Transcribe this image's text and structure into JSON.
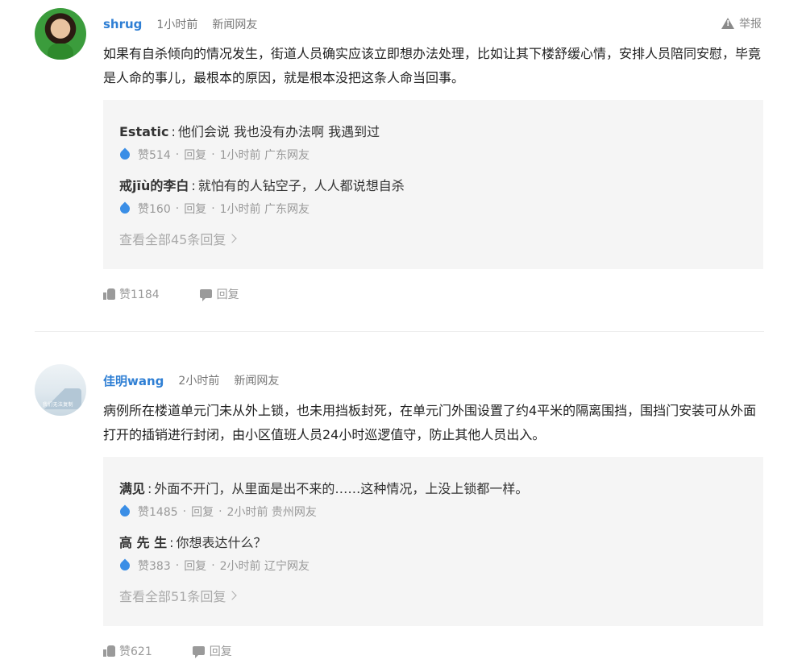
{
  "report_label": "举报",
  "comments": [
    {
      "username": "shrug",
      "time": "1小时前",
      "source": "新闻网友",
      "text": "如果有自杀倾向的情况发生，街道人员确实应该立即想办法处理，比如让其下楼舒缓心情，安排人员陪同安慰，毕竟是人命的事儿，最根本的原因，就是根本没把这条人命当回事。",
      "replies": [
        {
          "name": "Estatic",
          "text": "他们会说 我也没有办法啊 我遇到过",
          "likes": "赞514",
          "reply": "回复",
          "time": "1小时前",
          "location": "广东网友"
        },
        {
          "name": "戒jīù的李白",
          "text": "就怕有的人钻空子，人人都说想自杀",
          "likes": "赞160",
          "reply": "回复",
          "time": "1小时前",
          "location": "广东网友"
        }
      ],
      "view_all": "查看全部45条回复",
      "likes": "赞1184",
      "reply_label": "回复"
    },
    {
      "username": "佳明wang",
      "time": "2小时前",
      "source": "新闻网友",
      "avatar_caption": "我们无法复制",
      "text": "病例所在楼道单元门未从外上锁，也未用挡板封死，在单元门外围设置了约4平米的隔离围挡，围挡门安装可从外面打开的插销进行封闭，由小区值班人员24小时巡逻值守，防止其他人员出入。",
      "replies": [
        {
          "name": "满见",
          "text": "外面不开门，从里面是出不来的……这种情况，上没上锁都一样。",
          "likes": "赞1485",
          "reply": "回复",
          "time": "2小时前",
          "location": "贵州网友"
        },
        {
          "name": "高 先 生",
          "text": "你想表达什么？",
          "likes": "赞383",
          "reply": "回复",
          "time": "2小时前",
          "location": "辽宁网友"
        }
      ],
      "view_all": "查看全部51条回复",
      "likes": "赞621",
      "reply_label": "回复"
    }
  ]
}
